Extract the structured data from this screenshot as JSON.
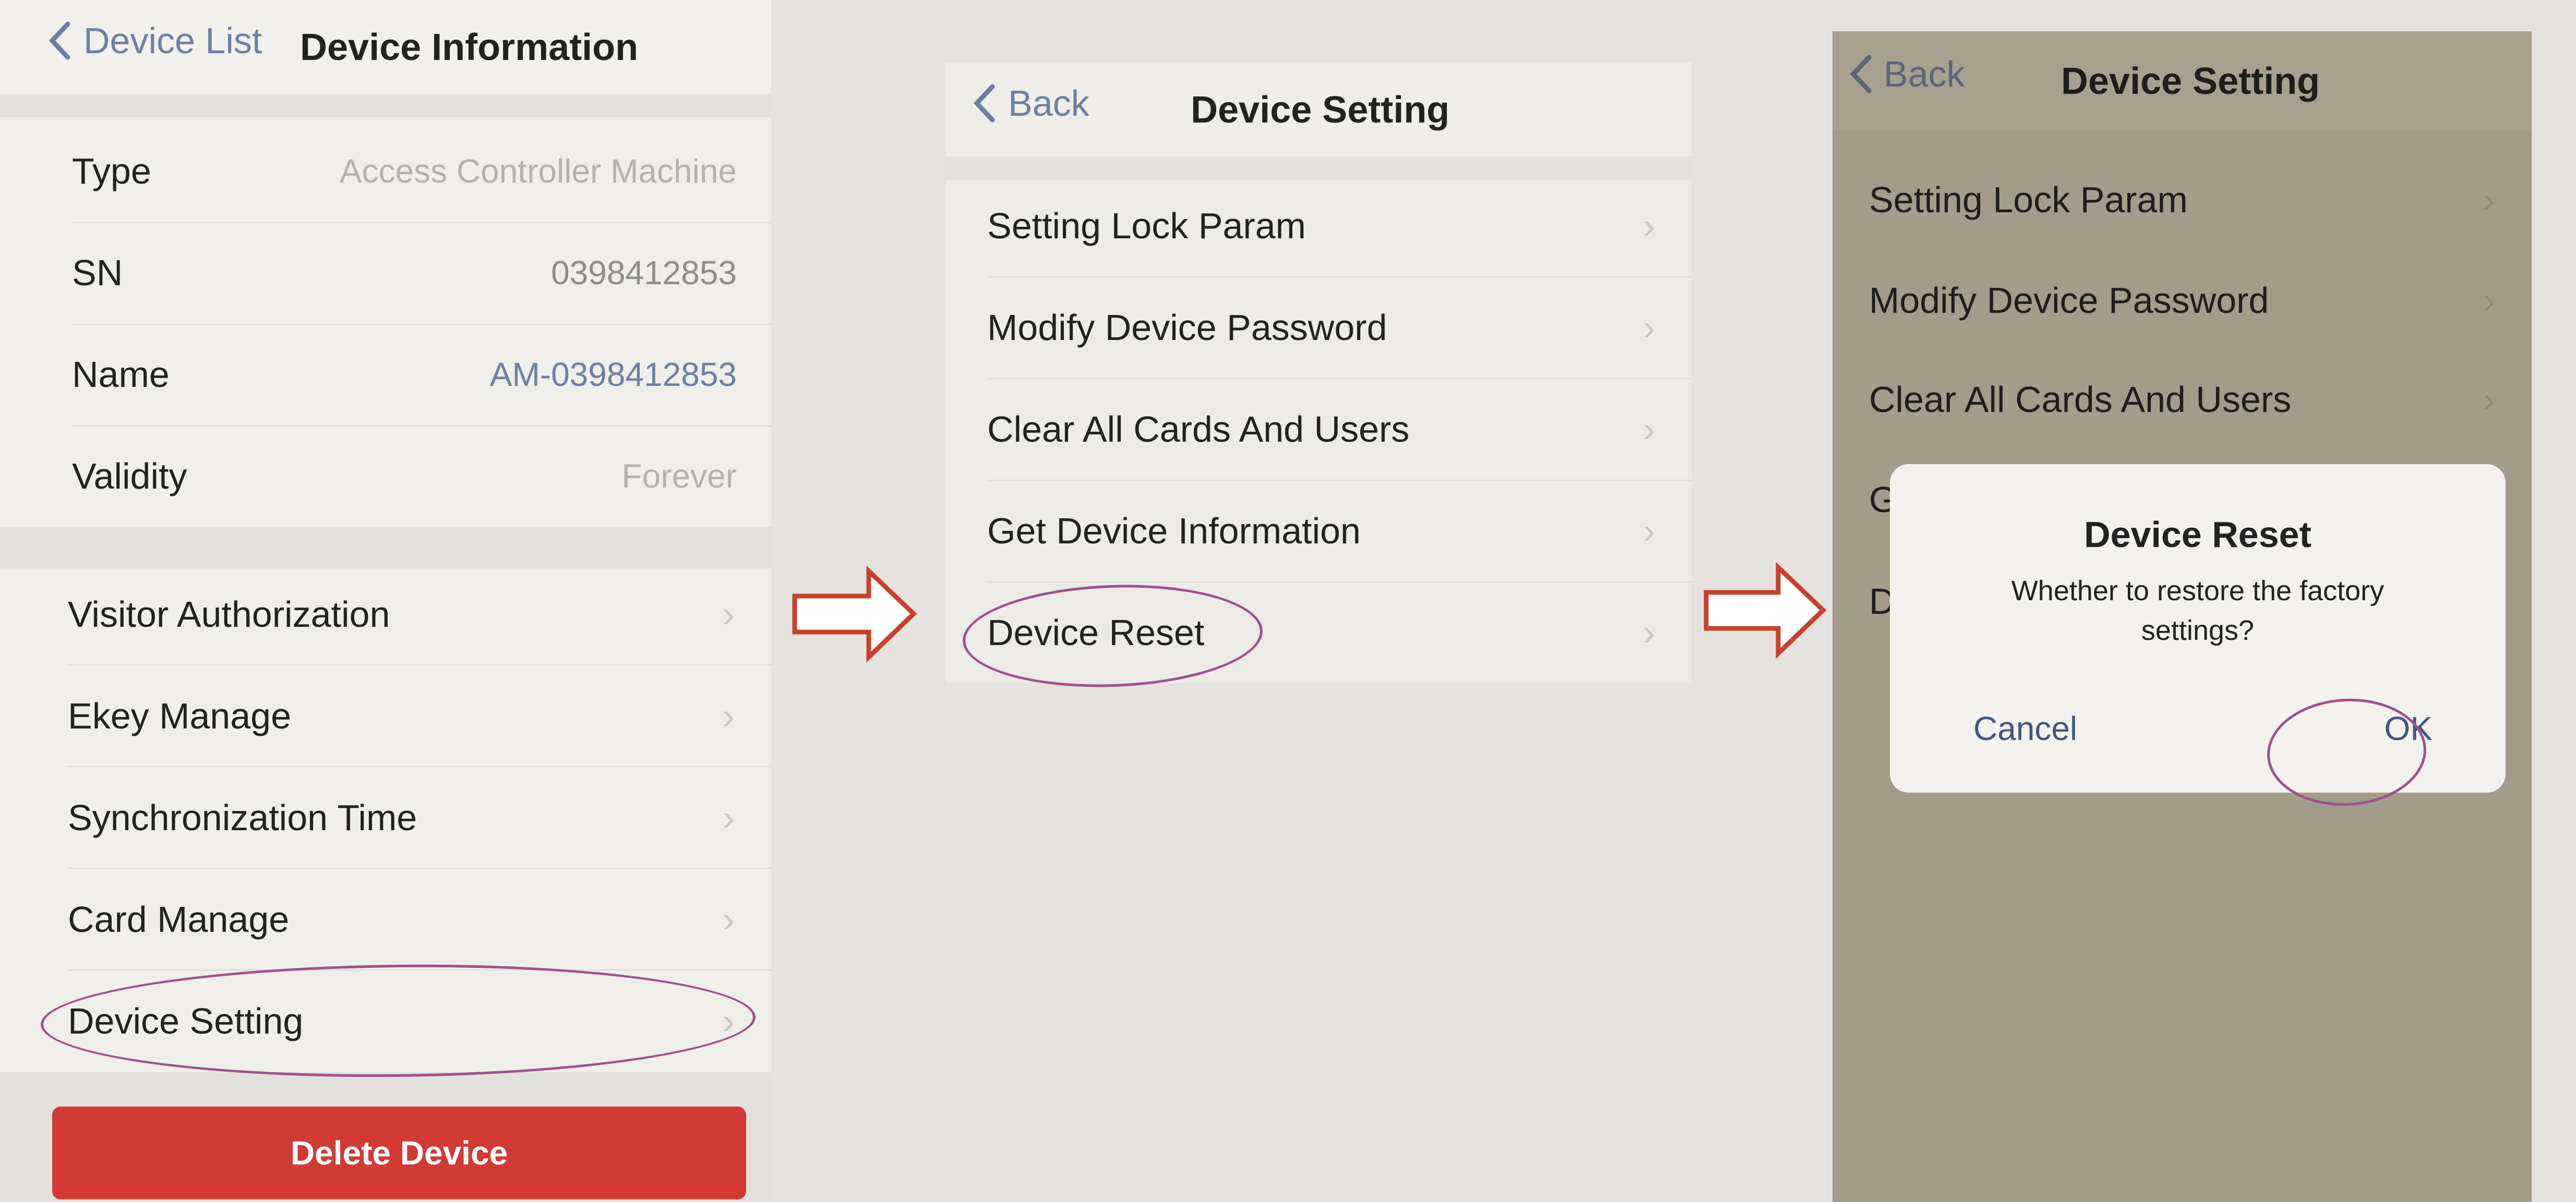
{
  "screen1": {
    "nav": {
      "back_label": "Device List",
      "title": "Device Information"
    },
    "info_rows": [
      {
        "label": "Type",
        "value": "Access Controller Machine"
      },
      {
        "label": "SN",
        "value": "0398412853"
      },
      {
        "label": "Name",
        "value": "AM-0398412853"
      },
      {
        "label": "Validity",
        "value": "Forever"
      }
    ],
    "menu_items": [
      {
        "label": "Visitor Authorization"
      },
      {
        "label": "Ekey Manage"
      },
      {
        "label": "Synchronization Time"
      },
      {
        "label": "Card Manage"
      },
      {
        "label": "Device Setting"
      }
    ],
    "delete_label": "Delete Device"
  },
  "screen2": {
    "nav": {
      "back_label": "Back",
      "title": "Device Setting"
    },
    "menu_items": [
      {
        "label": "Setting Lock Param"
      },
      {
        "label": "Modify Device Password"
      },
      {
        "label": "Clear All Cards And Users"
      },
      {
        "label": "Get Device Information"
      },
      {
        "label": "Device Reset"
      }
    ]
  },
  "screen3": {
    "nav": {
      "back_label": "Back",
      "title": "Device Setting"
    },
    "menu_items": [
      {
        "label": "Setting Lock Param"
      },
      {
        "label": "Modify Device Password"
      },
      {
        "label": "Clear All Cards And Users"
      },
      {
        "label": "G"
      },
      {
        "label": "D"
      }
    ],
    "dialog": {
      "title": "Device Reset",
      "message": "Whether to restore the factory settings?",
      "cancel_label": "Cancel",
      "ok_label": "OK"
    }
  },
  "colors": {
    "accent_red": "#d23a34",
    "arrow_red": "#c8412d",
    "highlight_ellipse": "#a0508a",
    "link_blue": "#46557a",
    "overlay": "#a29d8a"
  },
  "icons": [
    "chevron-left-icon",
    "chevron-right-icon",
    "arrow-right-outline-icon"
  ]
}
